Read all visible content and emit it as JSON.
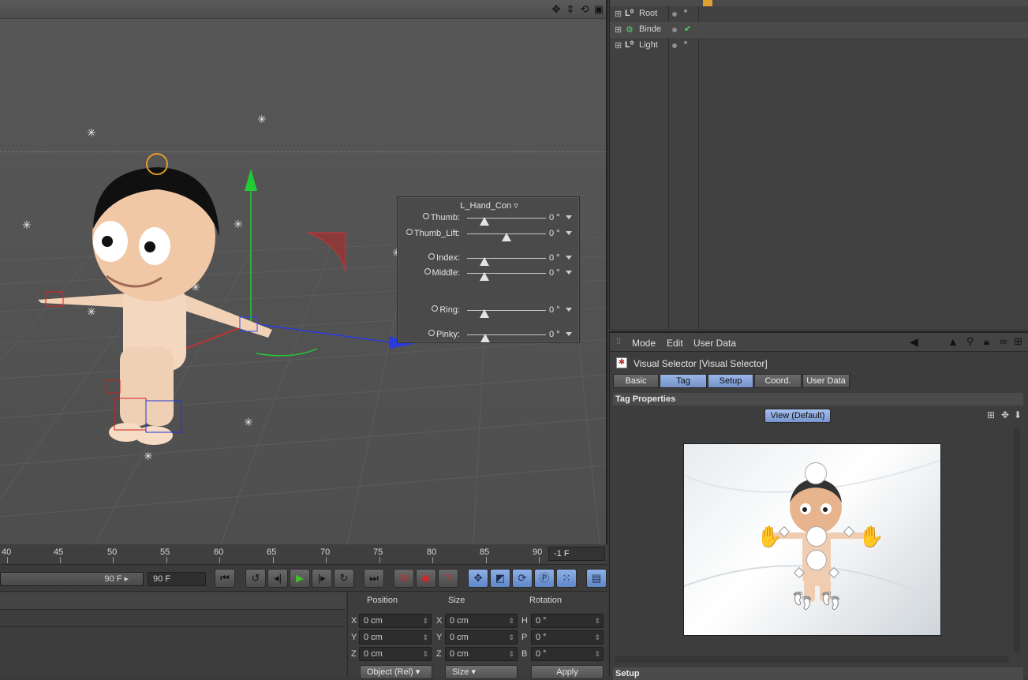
{
  "viewport": {
    "nav_icons": [
      "move-view-icon",
      "dolly-view-icon",
      "rotate-view-icon",
      "maximize-view-icon"
    ]
  },
  "finger_panel": {
    "title": "L_Hand_Con",
    "rows": [
      {
        "label": "Thumb:",
        "value": "0 °",
        "level": 0.22
      },
      {
        "label": "Thumb_Lift:",
        "value": "0 °",
        "level": 0.5
      },
      {
        "label": "Index:",
        "value": "0 °",
        "level": 0.22
      },
      {
        "label": "Middle:",
        "value": "0 °",
        "level": 0.22
      },
      {
        "label": "Ring:",
        "value": "0 °",
        "level": 0.22
      },
      {
        "label": "Pinky:",
        "value": "0 °",
        "level": 0.23
      }
    ]
  },
  "timeline": {
    "ticks": [
      "40",
      "45",
      "50",
      "55",
      "60",
      "65",
      "70",
      "75",
      "80",
      "85",
      "90"
    ],
    "current_frame": "-1 F"
  },
  "transport": {
    "end_slider_value": "90 F",
    "end_frame": "90 F"
  },
  "coords": {
    "headers": {
      "position": "Position",
      "size": "Size",
      "rotation": "Rotation"
    },
    "pos_labels": [
      "X",
      "Y",
      "Z"
    ],
    "size_labels": [
      "X",
      "Y",
      "Z"
    ],
    "rot_labels": [
      "H",
      "P",
      "B"
    ],
    "position": [
      "0 cm",
      "0 cm",
      "0 cm"
    ],
    "size": [
      "0 cm",
      "0 cm",
      "0 cm"
    ],
    "rotation": [
      "0 °",
      "0 °",
      "0 °"
    ],
    "mode_dropdown": "Object (Rel)",
    "size_dropdown": "Size",
    "apply": "Apply"
  },
  "object_manager": {
    "items": [
      {
        "name": "Root"
      },
      {
        "name": "Binde"
      },
      {
        "name": "Light"
      }
    ]
  },
  "attribute_manager": {
    "menu": [
      "Mode",
      "Edit",
      "User Data"
    ],
    "title": "Visual Selector [Visual Selector]",
    "tabs": [
      "Basic",
      "Tag",
      "Setup",
      "Coord.",
      "User Data"
    ],
    "section_tag": "Tag Properties",
    "view_button": "View (Default)",
    "section_setup": "Setup"
  }
}
